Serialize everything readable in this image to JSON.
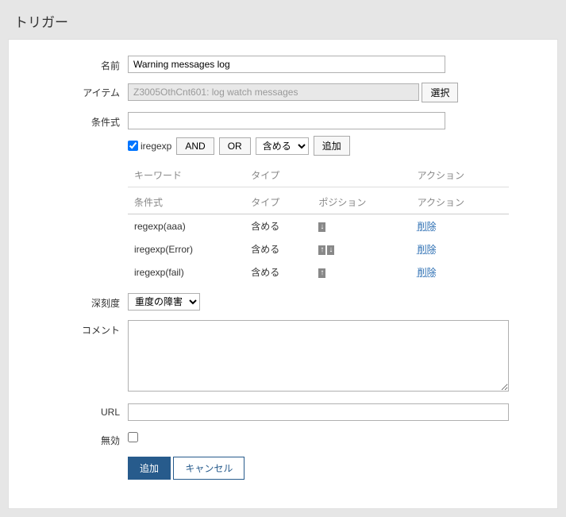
{
  "page_title": "トリガー",
  "labels": {
    "name": "名前",
    "item": "アイテム",
    "select": "選択",
    "condition_expr": "条件式",
    "iregexp": "iregexp",
    "and": "AND",
    "or": "OR",
    "include_option": "含める",
    "add_btn": "追加",
    "col_keyword": "キーワード",
    "col_type": "タイプ",
    "col_action": "アクション",
    "col_cond": "条件式",
    "col_type2": "タイプ",
    "col_position": "ポジション",
    "col_action2": "アクション",
    "severity": "深刻度",
    "severity_value": "重度の障害",
    "comment": "コメント",
    "url": "URL",
    "disabled": "無効",
    "submit_add": "追加",
    "cancel": "キャンセル",
    "delete": "削除"
  },
  "values": {
    "name": "Warning messages log",
    "item": "Z3005OthCnt601: log watch messages",
    "condition_expr": "",
    "comment": "",
    "url": "",
    "iregexp_checked": true,
    "disabled_checked": false
  },
  "conditions": [
    {
      "expr": "regexp(aaa)",
      "type": "含める",
      "pos": "down"
    },
    {
      "expr": "iregexp(Error)",
      "type": "含める",
      "pos": "updown"
    },
    {
      "expr": "iregexp(fail)",
      "type": "含める",
      "pos": "up"
    }
  ]
}
